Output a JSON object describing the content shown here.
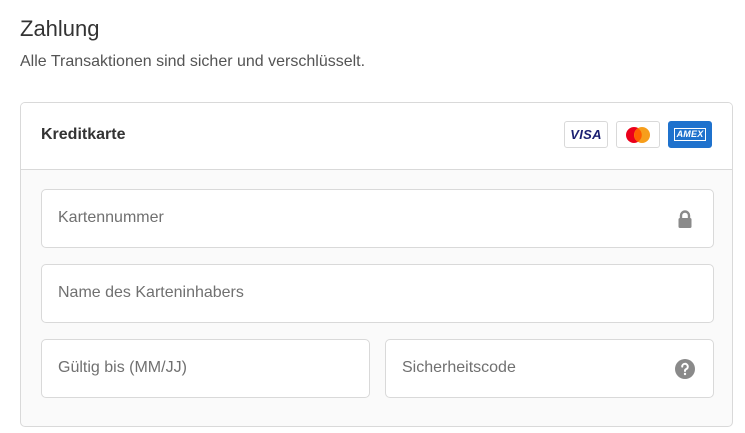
{
  "header": {
    "title": "Zahlung",
    "subtitle": "Alle Transaktionen sind sicher und verschlüsselt."
  },
  "payment": {
    "method_label": "Kreditkarte",
    "brands": [
      {
        "name": "visa",
        "label": "VISA"
      },
      {
        "name": "mastercard"
      },
      {
        "name": "amex",
        "label": "AMEX"
      }
    ],
    "fields": {
      "card_number": {
        "value": "",
        "placeholder": "Kartennummer",
        "icon": "lock-icon"
      },
      "cardholder_name": {
        "value": "",
        "placeholder": "Name des Karteninhabers"
      },
      "expiry": {
        "value": "",
        "placeholder": "Gültig bis (MM/JJ)"
      },
      "security_code": {
        "value": "",
        "placeholder": "Sicherheitscode",
        "icon": "help-icon"
      }
    }
  },
  "colors": {
    "border": "#d9d9d9",
    "panel_background": "#fafafa",
    "placeholder_text": "#707070",
    "icon_gray": "#8a8a8a",
    "visa_blue": "#1a1f71",
    "mastercard_red": "#eb001b",
    "mastercard_orange": "#f79e1b",
    "amex_blue": "#1f72cd"
  }
}
